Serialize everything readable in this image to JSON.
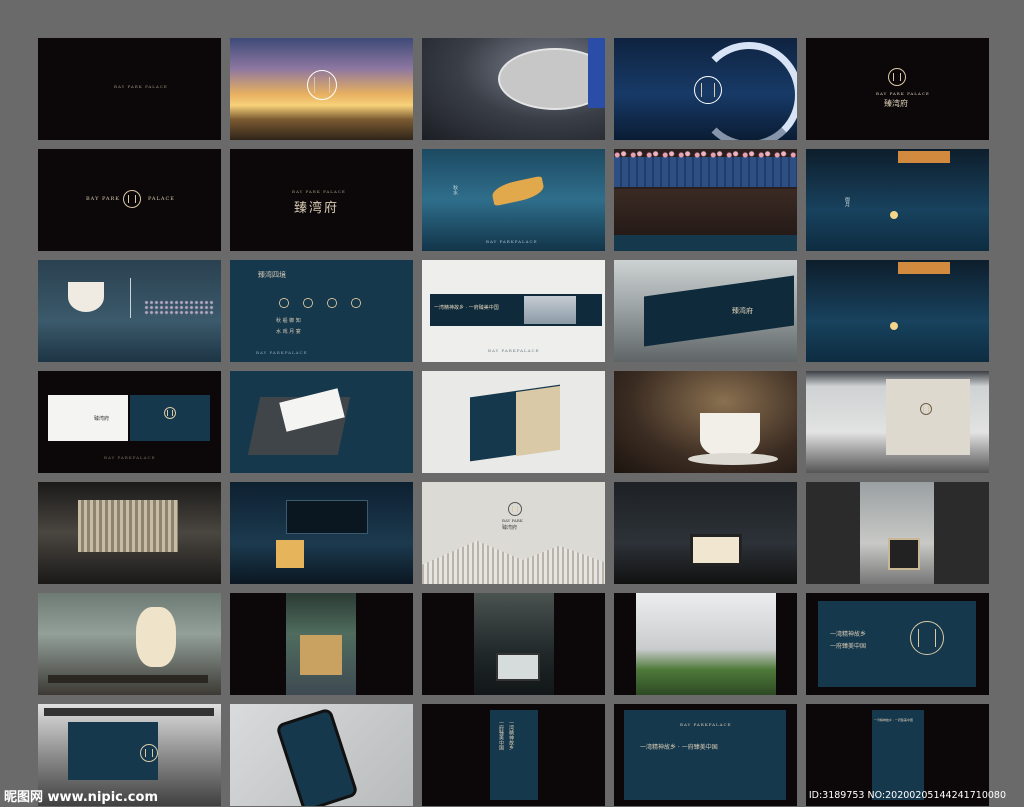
{
  "texts": {
    "bay_park_palace": "BAY PARK PALACE",
    "bay_park": "BAY PARK",
    "bay": "BAY",
    "park": "PARK",
    "palace": "PALACE",
    "bay_parkpalace": "BAY PARKPALACE",
    "brand_cn": "臻湾府",
    "four_realms": "臻湾四境",
    "four_row1": "秋  船  御  知",
    "four_row2": "水  戏  月  宴",
    "slogan_full": "一湾精神故乡 · 一府臻美中国",
    "slogan_a": "一湾精神故乡",
    "slogan_b": "一府臻美中国",
    "vertical_a": "秋水",
    "vertical_b": "御月"
  },
  "watermark": {
    "site_cn": "昵图网",
    "site_url": "www.nipic.com",
    "id_text": "ID:3189753 NO:20200205144241710080"
  }
}
